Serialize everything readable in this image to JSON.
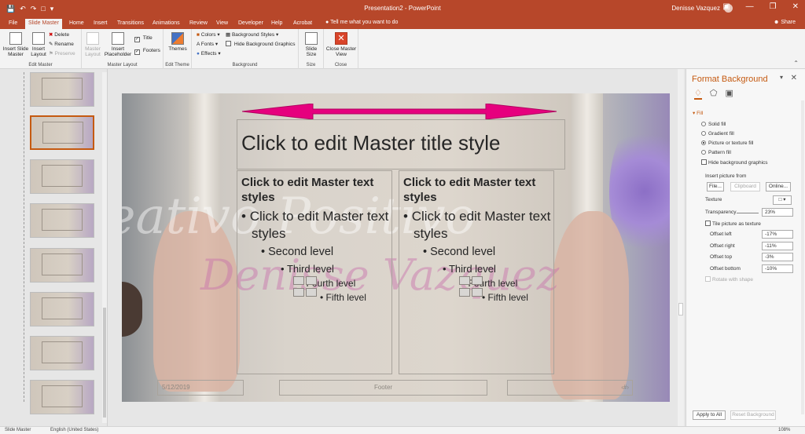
{
  "titlebar": {
    "doc_title": "Presentation2  -  PowerPoint",
    "user_name": "Denisse Vazquez",
    "qat": [
      "save-icon",
      "undo-icon",
      "redo-icon",
      "start-from-beginning-icon",
      "customize-qat-icon"
    ],
    "window_buttons": [
      "ribbon-display-icon",
      "minimize-icon",
      "restore-icon",
      "close-icon"
    ]
  },
  "tabs": {
    "items": [
      "File",
      "Slide Master",
      "Home",
      "Insert",
      "Transitions",
      "Animations",
      "Review",
      "View",
      "Developer",
      "Help",
      "Acrobat"
    ],
    "active": "Slide Master",
    "tell_me": "Tell me what you want to do",
    "share": "Share"
  },
  "ribbon": {
    "edit_master": {
      "label": "Edit Master",
      "insert_slide_master": "Insert Slide Master",
      "insert_layout": "Insert Layout",
      "delete": "Delete",
      "rename": "Rename",
      "preserve": "Preserve"
    },
    "master_layout": {
      "label": "Master Layout",
      "master_layout": "Master Layout",
      "insert_placeholder": "Insert Placeholder",
      "title": "Title",
      "footers": "Footers"
    },
    "edit_theme": {
      "label": "Edit Theme",
      "themes": "Themes"
    },
    "background": {
      "label": "Background",
      "colors": "Colors",
      "fonts": "Fonts",
      "effects": "Effects",
      "background_styles": "Background Styles",
      "hide_background_graphics": "Hide Background Graphics"
    },
    "size": {
      "label": "Size",
      "slide_size": "Slide Size"
    },
    "close": {
      "label": "Close",
      "close_master_view": "Close Master View"
    }
  },
  "slide": {
    "title": "Click to edit Master title style",
    "columns": [
      {
        "heading": "Click to edit Master text styles",
        "level1": "Click to edit Master text styles",
        "level2": "Second level",
        "level3": "Third level",
        "level4": "Fourth level",
        "level5": "Fifth level"
      },
      {
        "heading": "Click to edit Master text styles",
        "level1": "Click to edit Master text styles",
        "level2": "Second level",
        "level3": "Third level",
        "level4": "Fourth level",
        "level5": "Fifth level"
      }
    ],
    "date": "5/12/2019",
    "footer": "Footer",
    "slide_number": "‹#›",
    "watermark_top": "Creativo Positivo",
    "watermark_bottom": "Denisse Vazquez"
  },
  "format_pane": {
    "title": "Format Background",
    "section": "Fill",
    "options": [
      {
        "label": "Solid fill",
        "selected": false
      },
      {
        "label": "Gradient fill",
        "selected": false
      },
      {
        "label": "Picture or texture fill",
        "selected": true
      },
      {
        "label": "Pattern fill",
        "selected": false
      }
    ],
    "hide_background_graphics": "Hide background graphics",
    "insert_picture_from": "Insert picture from",
    "file_btn": "File...",
    "clipboard_btn": "Clipboard",
    "online_btn": "Online...",
    "texture": "Texture",
    "transparency_label": "Transparency",
    "transparency_value": "23%",
    "tile_picture": "Tile picture as texture",
    "offset_left_label": "Offset left",
    "offset_left": "-17%",
    "offset_right_label": "Offset right",
    "offset_right": "-11%",
    "offset_top_label": "Offset top",
    "offset_top": "-3%",
    "offset_bottom_label": "Offset bottom",
    "offset_bottom": "-10%",
    "rotate_with_shape": "Rotate with shape",
    "apply_to_all": "Apply to All",
    "reset_background": "Reset Background"
  },
  "statusbar": {
    "view": "Slide Master",
    "language": "English (United States)",
    "zoom": "108%"
  },
  "colors": {
    "accent": "#b7472a",
    "pane_accent": "#c55a11",
    "arrow": "#e6007e"
  }
}
